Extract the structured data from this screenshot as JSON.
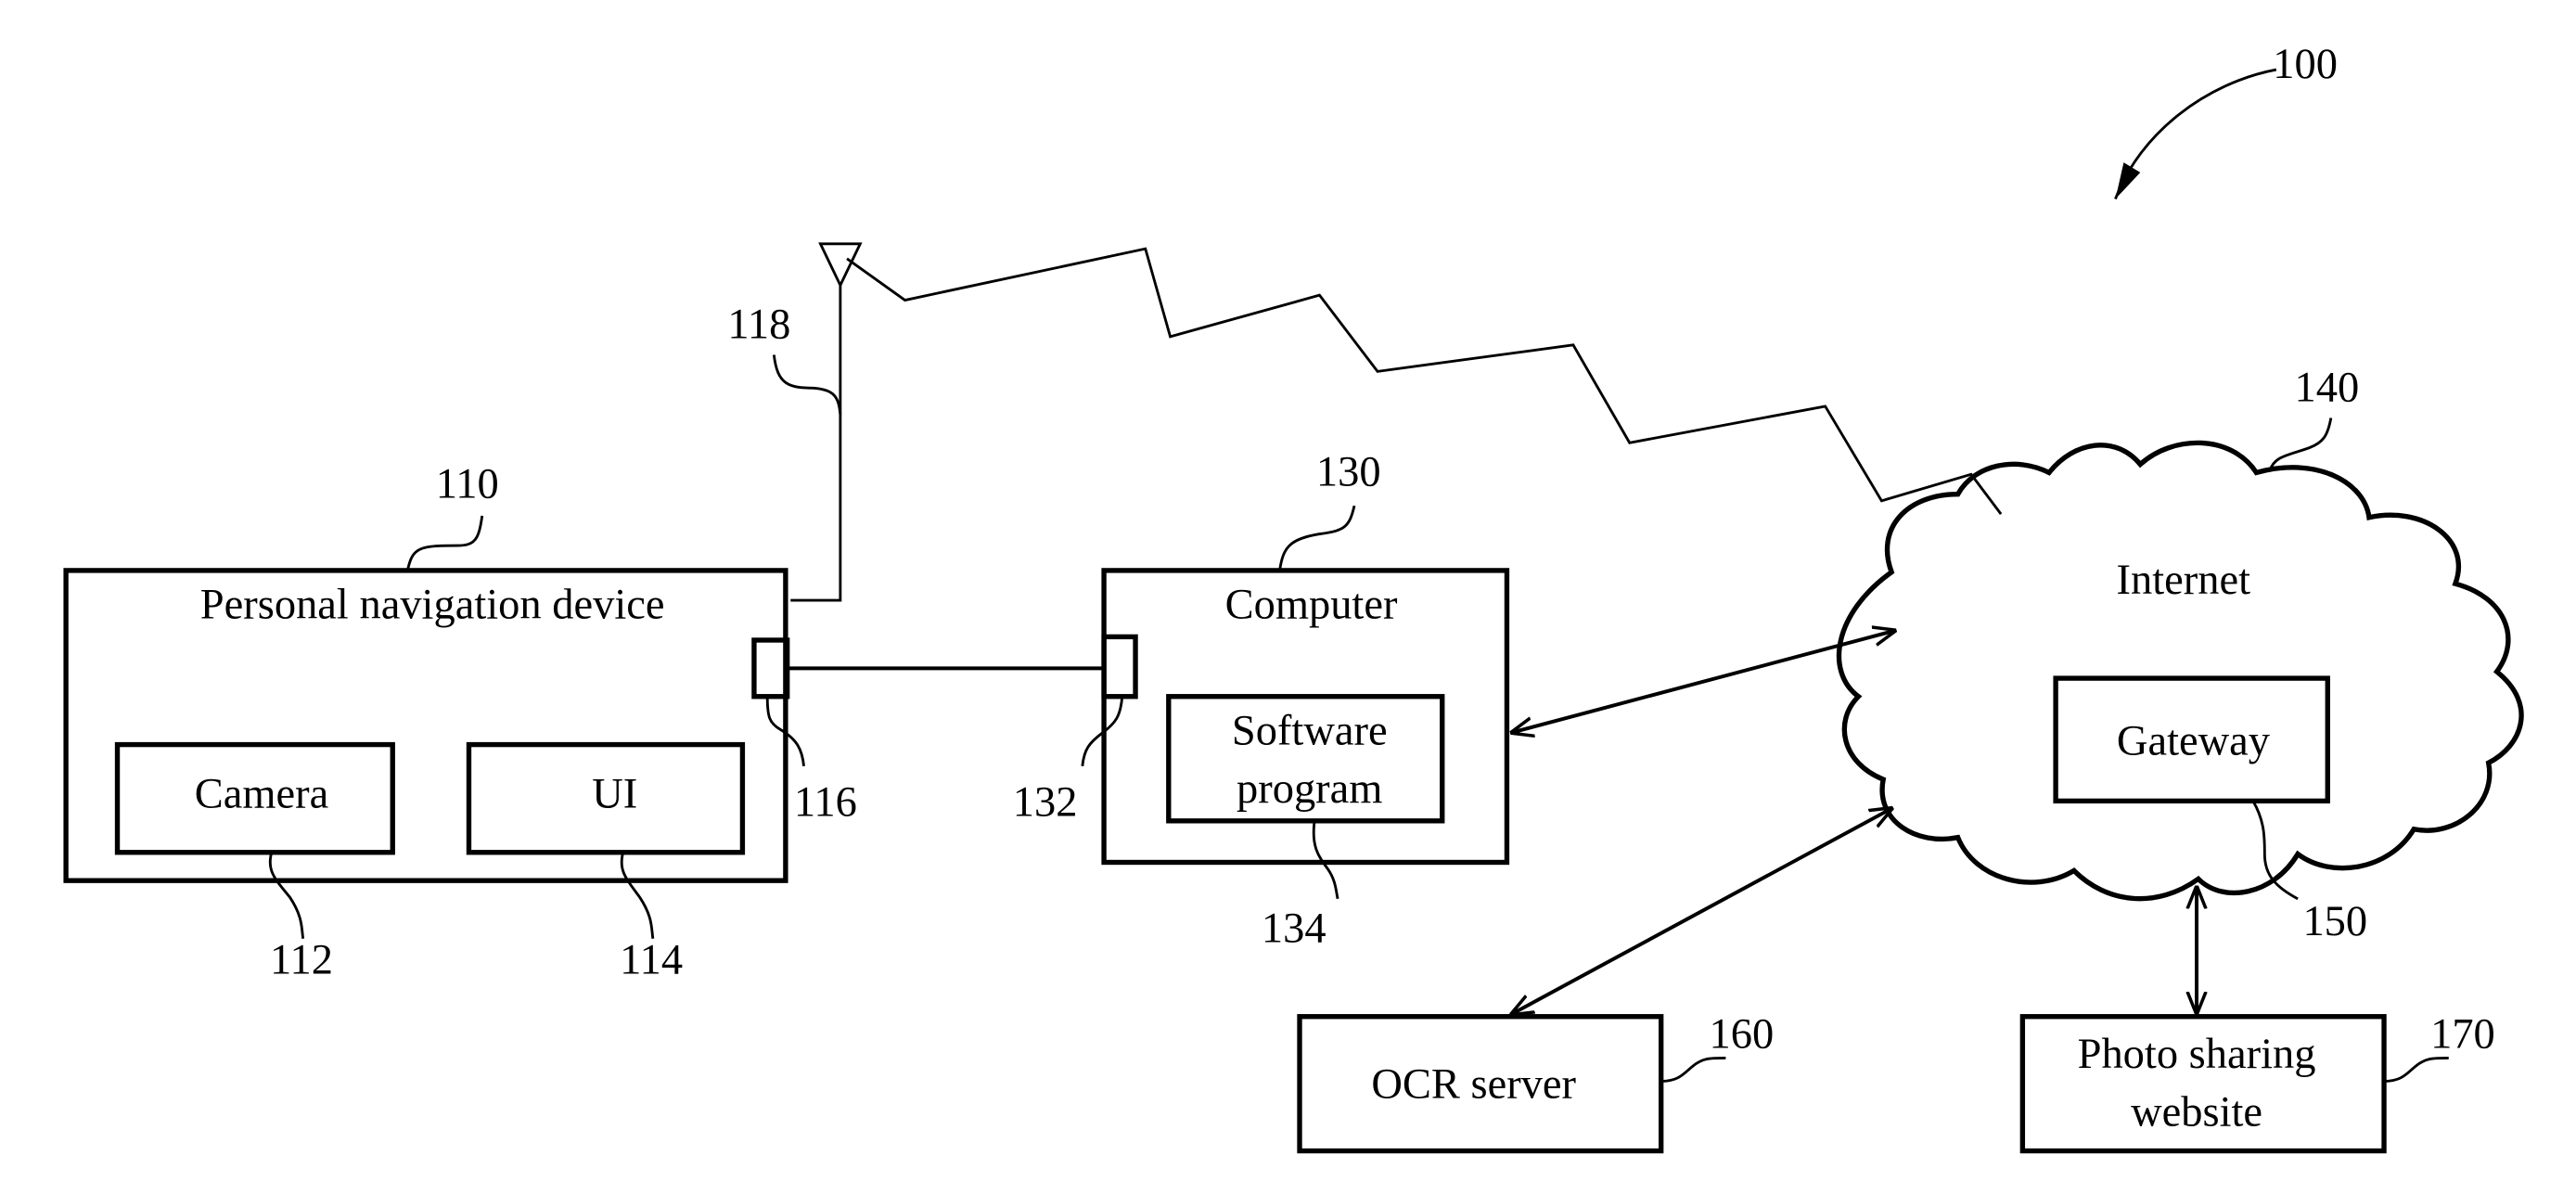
{
  "figure": {
    "system_ref": "100",
    "colors": {
      "line": "#000000",
      "background": "#ffffff"
    }
  },
  "nodes": {
    "pnd": {
      "label": "Personal navigation device",
      "ref": "110"
    },
    "camera": {
      "label": "Camera",
      "ref": "112"
    },
    "ui": {
      "label": "UI",
      "ref": "114"
    },
    "pnd_port": {
      "ref": "116"
    },
    "antenna": {
      "ref": "118"
    },
    "computer": {
      "label": "Computer",
      "ref": "130"
    },
    "computer_port": {
      "ref": "132"
    },
    "software": {
      "label_line1": "Software",
      "label_line2": "program",
      "ref": "134"
    },
    "internet": {
      "label": "Internet",
      "ref": "140"
    },
    "gateway": {
      "label": "Gateway",
      "ref": "150"
    },
    "ocr": {
      "label": "OCR server",
      "ref": "160"
    },
    "photo": {
      "label_line1": "Photo sharing",
      "label_line2": "website",
      "ref": "170"
    }
  }
}
